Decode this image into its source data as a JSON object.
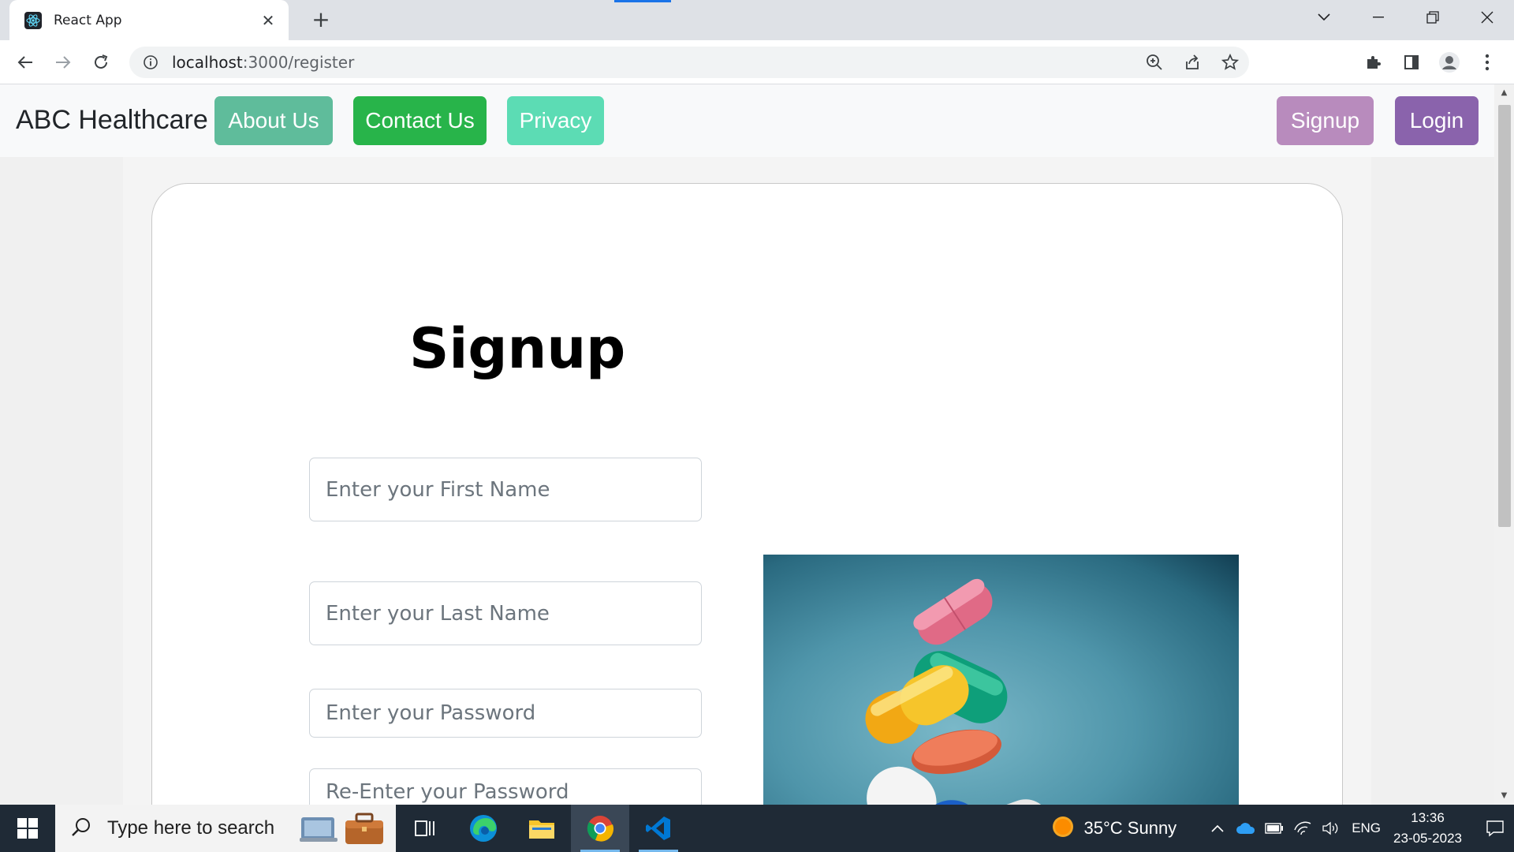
{
  "browser": {
    "tab_title": "React App",
    "url_host": "localhost",
    "url_path": ":3000/register"
  },
  "navbar": {
    "brand": "ABC Healthcare",
    "about": "About Us",
    "contact": "Contact Us",
    "privacy": "Privacy",
    "signup": "Signup",
    "login": "Login",
    "colors": {
      "about": "#5fbc9b",
      "contact": "#28b44a",
      "privacy": "#5cdcb4",
      "signup": "#b88bbd",
      "login": "#8a63ac"
    }
  },
  "form": {
    "title": "Signup",
    "first_name_placeholder": "Enter your First Name",
    "last_name_placeholder": "Enter your Last Name",
    "password_placeholder": "Enter your Password",
    "reenter_password_placeholder": "Re-Enter your Password"
  },
  "image": {
    "description": "colorful-pills-stack"
  },
  "taskbar": {
    "search_placeholder": "Type here to search",
    "weather": "35°C  Sunny",
    "language": "ENG",
    "time": "13:36",
    "date": "23-05-2023"
  }
}
